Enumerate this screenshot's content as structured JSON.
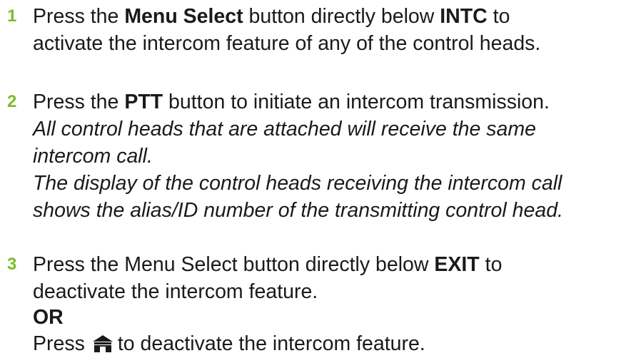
{
  "accent_color": "#7dbb2e",
  "steps": [
    {
      "number": "1",
      "line1": {
        "a": "Press the ",
        "b": "Menu Select",
        "c": " button directly below ",
        "d": "INTC",
        "e": " to"
      },
      "line2": "activate the intercom feature of any of the control heads."
    },
    {
      "number": "2",
      "line1": {
        "a": "Press the ",
        "b": "PTT",
        "c": " button to initiate an intercom transmission."
      },
      "italic_lines": [
        "All control heads that are attached will receive the same",
        "intercom call.",
        "The display of the control heads receiving the intercom call",
        "shows the alias/ID number of the transmitting control head."
      ]
    },
    {
      "number": "3",
      "line1": {
        "a": "Press the Menu Select button directly below ",
        "b": "EXIT",
        "c": " to"
      },
      "line2": "deactivate the intercom feature.",
      "or_label": "OR",
      "line4": {
        "a": "Press",
        "icon": "home-icon",
        "b": "to deactivate the intercom feature."
      }
    }
  ]
}
